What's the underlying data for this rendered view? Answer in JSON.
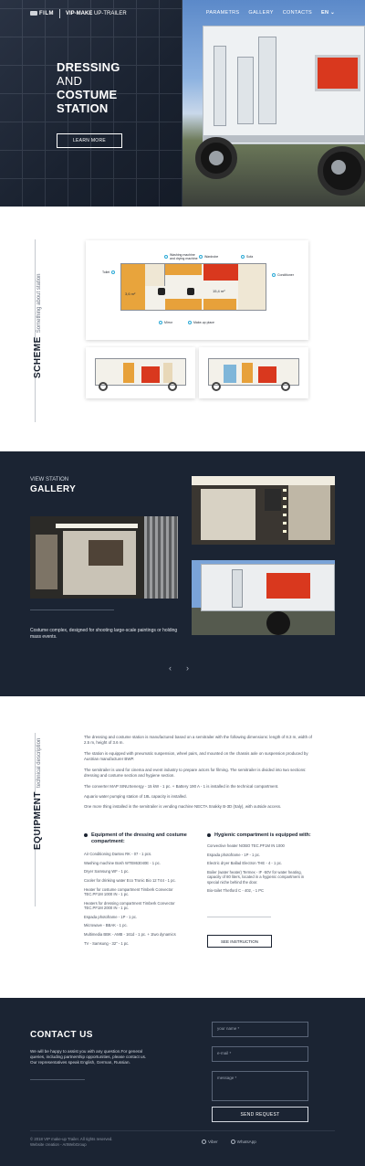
{
  "header": {
    "logo_film": "FILM",
    "logo_brand": "VIP-MAKE",
    "logo_sub": " UP-TRAILER",
    "nav": [
      "PARAMETRS",
      "GALLERY",
      "CONTACTS"
    ],
    "lang": "EN"
  },
  "hero": {
    "title_line1": "DRESSING",
    "title_line2": "AND",
    "title_line3": "COSTUME",
    "title_line4": "STATION",
    "button": "LEARN MORE"
  },
  "scheme": {
    "title": "SCHEME",
    "subtitle": "Something about station",
    "labels": {
      "washing": "Washing machine\nand drying machine",
      "wardrobe": "Wardrobe",
      "sofa": "Sofa",
      "toilet": "Toilet",
      "conditioner": "Conditioner",
      "mirror": "Mirror",
      "makeup": "Make-up place",
      "area1": "3,6 m²",
      "area2": "15,4 m²"
    }
  },
  "gallery": {
    "subtitle": "VIEW STATION",
    "title": "GALLERY",
    "caption": "Costume complex, designed for shooting large-scale paintings or holding mass events.",
    "prev": "‹",
    "next": "›"
  },
  "equipment": {
    "title": "EQUIPMENT",
    "subtitle": "technical description",
    "paragraphs": [
      "The dressing and costume station is manufactured based on a semitrailer with the following dimensions: length of 8.3 m, width of 2.5 m, height of 3.6 m.",
      "The station is equipped with pneumatic suspension, wheel pairs, and mounted on the chassis axle on suspension produced by Austrian manufacturer BWP.",
      "The semitrailer is used for cinema and event industry to prepare actors for filming. The semitrailer is divided into two sections: dressing and costume section and hygiene section.",
      "The converter MAP SINUSenergy - 15 kW - 1 pc. + Battery 190 A - 1 is installed in the technical compartment.",
      "Aquario water pumping station of 18L capacity is installed.",
      "One more thing installed in the semitrailer is vending machine NECTA Snakky B-3D (Italy), with outside access."
    ],
    "left_title": "Equipment of the dressing and costume compartment:",
    "left_items": [
      "Air Conditioning Dantex RK - 07 - 1 pcs.",
      "Washing machine Bosh WTE863040E - 1 pc.",
      "Dryer Samsung WF - 1 pc.",
      "Cooler for drinking water Eco Tronic Bio 12 T44 - 1 pc.",
      "Heater for costume compartment Timberk Convector TEC.PF1M 1000 IN - 1 pc.",
      "Heaters for dressing compartment Timberk Convector TEC.PF1M 2000 IN - 1 pc.",
      "Espada photoframe - 1P - 1 pc.",
      "Microwave - BBAK - 1 pc.",
      "Multimedia BBK - AMB - 161d - 1 pc. + 1two dynamics",
      "TV - Samsung - 32\" - 1 pc."
    ],
    "right_title": "Hygienic compartment is equipped with:",
    "right_items": [
      "Convective heater NOBO TEC.PF1M IN 1000",
      "Espada photoframe - 1P - 1 pc.",
      "Electric dryer Ballad Electron THE - 4 - 1 pc.",
      "Boiler (water heater) Termex - IF -50V for water heating, capacity of 80 liters, located in a hygienic compartment in special niche behind the door.",
      "Bio-toilet Thetford C - 402, - 1 PC"
    ],
    "button": "SEE INSTRUCTION"
  },
  "contact": {
    "title": "CONTACT US",
    "text": "We will be happy to assist you with any question.For general queries, including partnership opportunities, please contact us. Our representatives speak English, German, Russian.",
    "name_placeholder": "your name *",
    "email_placeholder": "e-mail *",
    "message_placeholder": "message *",
    "button": "SEND REQUEST",
    "copyright": "© 2018 VIP make-up Trailer. All rights reserved.",
    "creation": "Website creation - ArtWebGroup",
    "socials": [
      "Viber",
      "WhatsApp"
    ]
  },
  "colors": {
    "navy": "#1b2433",
    "accent_red": "#d9381e",
    "callout_blue": "#2aa9d6"
  }
}
